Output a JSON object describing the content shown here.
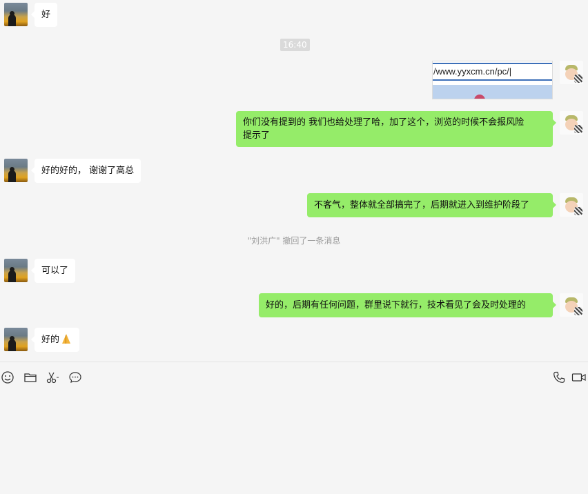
{
  "chat": {
    "timestamp": "16:40",
    "screenshot_url_text": "/www.yyxcm.cn/pc/|",
    "recall_notice": "\"刘洪广\" 撤回了一条消息",
    "messages": [
      {
        "side": "left",
        "text": "好"
      },
      {
        "side": "right",
        "type": "image",
        "text": "/www.yyxcm.cn/pc/|"
      },
      {
        "side": "right",
        "text_line1": "你们没有提到的 我们也给处理了哈，加了这个，浏览的时候不会报风险",
        "text_line2": "提示了"
      },
      {
        "side": "left",
        "text": "好的好的， 谢谢了高总"
      },
      {
        "side": "right",
        "text": "不客气，整体就全部搞完了，后期就进入到维护阶段了"
      },
      {
        "side": "left",
        "text": "可以了"
      },
      {
        "side": "right",
        "text": "好的，后期有任何问题，群里说下就行，技术看见了会及时处理的"
      },
      {
        "side": "left",
        "text": "好的",
        "emoji": "pray-emoji"
      }
    ]
  },
  "toolbar": {
    "left_icons": [
      "emoji-icon",
      "folder-icon",
      "scissors-icon",
      "chat-bubble-icon"
    ],
    "right_icons": [
      "phone-icon",
      "video-camera-icon"
    ]
  },
  "colors": {
    "background": "#f5f5f5",
    "sent_bubble": "#95ec69",
    "received_bubble": "#ffffff",
    "time_badge": "#dadada",
    "recall_text": "#9a9a9a"
  }
}
